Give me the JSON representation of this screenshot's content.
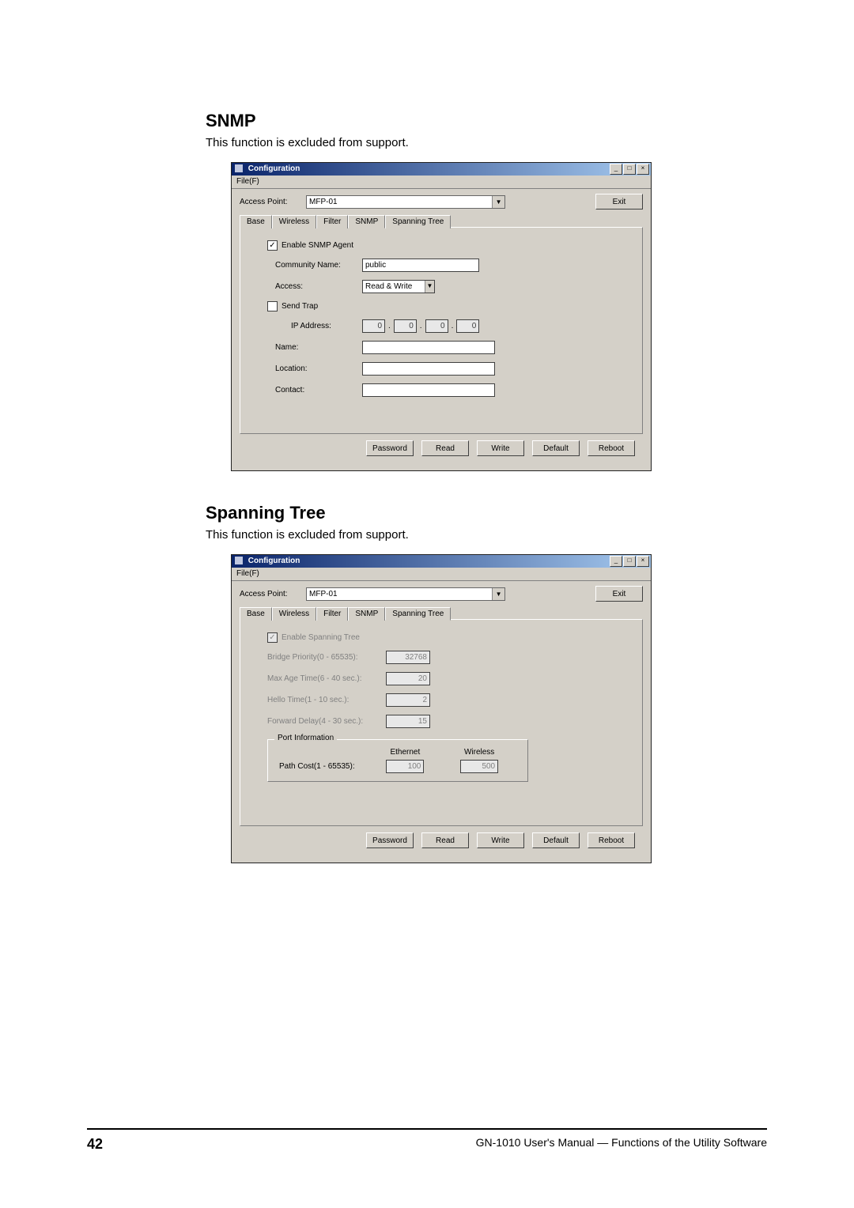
{
  "section1": {
    "title": "SNMP",
    "desc": "This function is excluded from support."
  },
  "section2": {
    "title": "Spanning Tree",
    "desc": "This function is excluded from support."
  },
  "win_common": {
    "title": "Configuration",
    "menu_file": "File(F)",
    "ap_label": "Access Point:",
    "ap_value": "MFP-01",
    "exit": "Exit",
    "btn_password": "Password",
    "btn_read": "Read",
    "btn_write": "Write",
    "btn_default": "Default",
    "btn_reboot": "Reboot"
  },
  "tabs": {
    "base": "Base",
    "wireless": "Wireless",
    "filter": "Filter",
    "snmp": "SNMP",
    "spanning": "Spanning Tree"
  },
  "snmp": {
    "enable": "Enable SNMP Agent",
    "community_label": "Community Name:",
    "community_value": "public",
    "access_label": "Access:",
    "access_value": "Read & Write",
    "sendtrap": "Send Trap",
    "ip_label": "IP Address:",
    "ip": [
      "0",
      "0",
      "0",
      "0"
    ],
    "name_label": "Name:",
    "location_label": "Location:",
    "contact_label": "Contact:"
  },
  "stp": {
    "enable": "Enable Spanning Tree",
    "bp_label": "Bridge Priority(0 - 65535):",
    "bp_value": "32768",
    "ma_label": "Max Age Time(6 - 40 sec.):",
    "ma_value": "20",
    "ht_label": "Hello Time(1 - 10 sec.):",
    "ht_value": "2",
    "fd_label": "Forward Delay(4 - 30 sec.):",
    "fd_value": "15",
    "port_group": "Port Information",
    "eth": "Ethernet",
    "wl": "Wireless",
    "pathcost_label": "Path Cost(1 - 65535):",
    "pc_eth": "100",
    "pc_wl": "500"
  },
  "footer": {
    "page": "42",
    "text": "GN-1010 User's Manual — Functions of the Utility Software"
  }
}
